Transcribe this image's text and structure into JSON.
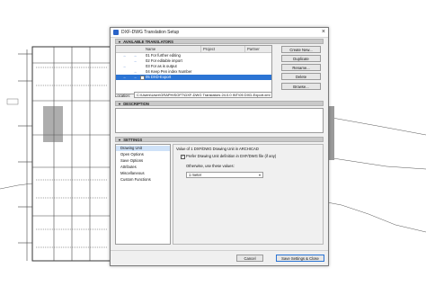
{
  "window": {
    "title": "DXF-DWG Translation Setup"
  },
  "translators": {
    "header": "AVAILABLE TRANSLATORS",
    "columns": {
      "name": "Name",
      "project": "Project",
      "partner": "Partner"
    },
    "rows": [
      {
        "name": "01 For further editing",
        "selected": false
      },
      {
        "name": "02 For editable import",
        "selected": false
      },
      {
        "name": "03 For as is output",
        "selected": false
      },
      {
        "name": "04 Keep Pen index Number",
        "selected": false
      },
      {
        "name": "05 DXD-Export",
        "selected": true
      }
    ],
    "buttons": {
      "create_new": "Create New...",
      "duplicate": "Duplicate",
      "rename": "Rename...",
      "delete": "Delete",
      "browse": "Browse..."
    },
    "location_label": "Location:",
    "location_value": "C:\\Users\\User\\GRAPHISOFT\\DXF-DWG Translators 24.0.0 INT\\05 DXD-Export.xml"
  },
  "description": {
    "header": "DESCRIPTION",
    "text": ""
  },
  "settings": {
    "header": "SETTINGS",
    "items": [
      "Drawing Unit",
      "Open Options",
      "Save Options",
      "Attributes",
      "Miscellaneous",
      "Custom Functions"
    ],
    "selected_index": 0,
    "pane": {
      "heading": "Value of 1 DXF/DWG Drawing Unit in ARCHICAD",
      "prefer_checkbox_label": "Prefer Drawing Unit definition in DXF/DWG file (if any)",
      "prefer_checked": true,
      "otherwise_label": "Otherwise, use these values:",
      "unit_value": "1 meter"
    }
  },
  "footer": {
    "cancel": "Cancel",
    "save": "Save Settings & Close"
  },
  "colors": {
    "selection": "#2b74d4",
    "accent_arrow": "#2f6ccf",
    "bg_plan": "#5a5a5a"
  }
}
